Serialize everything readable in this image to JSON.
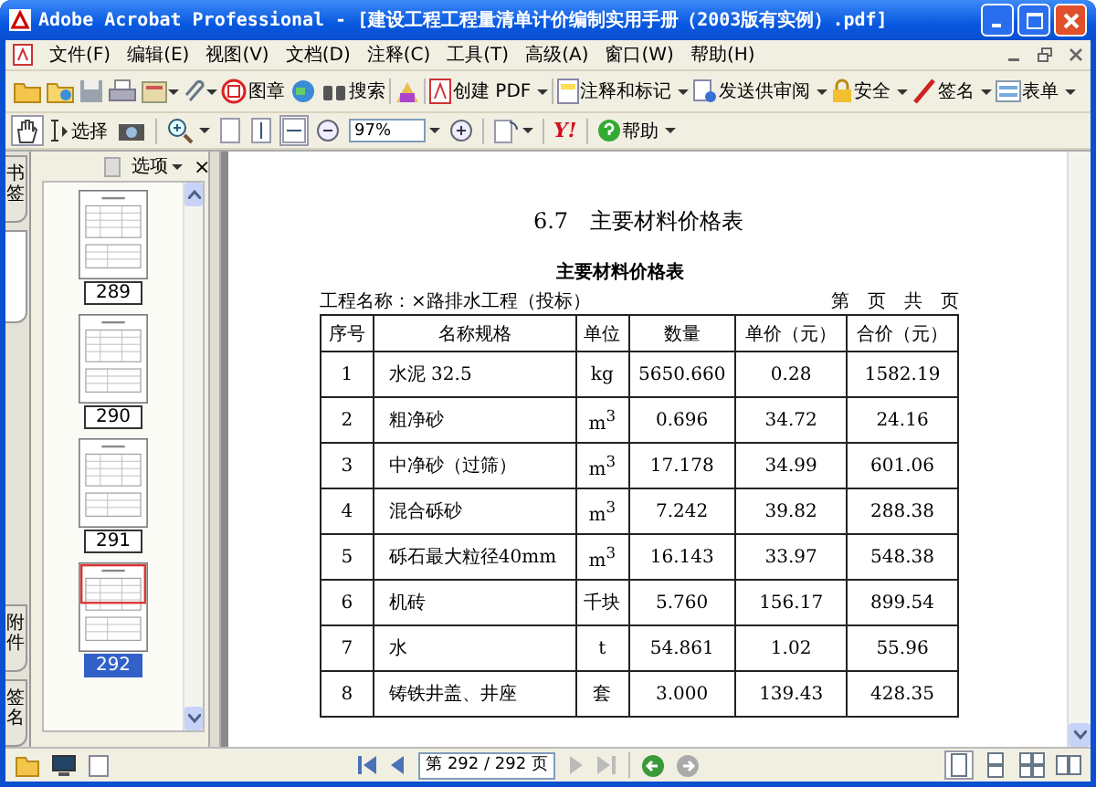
{
  "window": {
    "title": "Adobe Acrobat Professional - [建设工程工程量清单计价编制实用手册（2003版有实例）.pdf]"
  },
  "menu": [
    "文件(F)",
    "编辑(E)",
    "视图(V)",
    "文档(D)",
    "注释(C)",
    "工具(T)",
    "高级(A)",
    "窗口(W)",
    "帮助(H)"
  ],
  "toolbar1": {
    "labels": [
      "图章",
      "搜索",
      "创建 PDF",
      "注释和标记",
      "发送供审阅",
      "安全",
      "签名",
      "表单"
    ]
  },
  "toolbar2": {
    "select_label": "选择",
    "zoom": "97%",
    "yahoo": "Y!",
    "help": "帮助"
  },
  "sidebar": {
    "tabs": [
      {
        "label": "书签",
        "selected": false
      },
      {
        "selected": true
      },
      {
        "label": "附件",
        "selected": false
      },
      {
        "label": "签名",
        "selected": false
      }
    ],
    "options": "选项",
    "close": "×",
    "thumbnails": [
      {
        "page": "289",
        "selected": false
      },
      {
        "page": "290",
        "selected": false
      },
      {
        "page": "291",
        "selected": false
      },
      {
        "page": "292",
        "selected": true
      }
    ]
  },
  "document": {
    "heading": "6.7　主要材料价格表",
    "table_title": "主要材料价格表",
    "project": "工程名称：×路排水工程（投标）",
    "page_info": "第　页　共　页",
    "columns": [
      "序号",
      "名称规格",
      "单位",
      "数量",
      "单价（元）",
      "合价（元）"
    ],
    "rows": [
      [
        "1",
        "水泥 32.5",
        "kg",
        "5650.660",
        "0.28",
        "1582.19"
      ],
      [
        "2",
        "粗净砂",
        "m$^{3}$",
        "0.696",
        "34.72",
        "24.16"
      ],
      [
        "3",
        "中净砂（过筛）",
        "m$^{3}$",
        "17.178",
        "34.99",
        "601.06"
      ],
      [
        "4",
        "混合砾砂",
        "m$^{3}$",
        "7.242",
        "39.82",
        "288.38"
      ],
      [
        "5",
        "砾石最大粒径40mm",
        "m$^{3}$",
        "16.143",
        "33.97",
        "548.38"
      ],
      [
        "6",
        "机砖",
        "千块",
        "5.760",
        "156.17",
        "899.54"
      ],
      [
        "7",
        "水",
        "t",
        "54.861",
        "1.02",
        "55.96"
      ],
      [
        "8",
        "铸铁井盖、井座",
        "套",
        "3.000",
        "139.43",
        "428.35"
      ]
    ]
  },
  "status_bar": {
    "page_field": "第 292 / 292 页"
  }
}
